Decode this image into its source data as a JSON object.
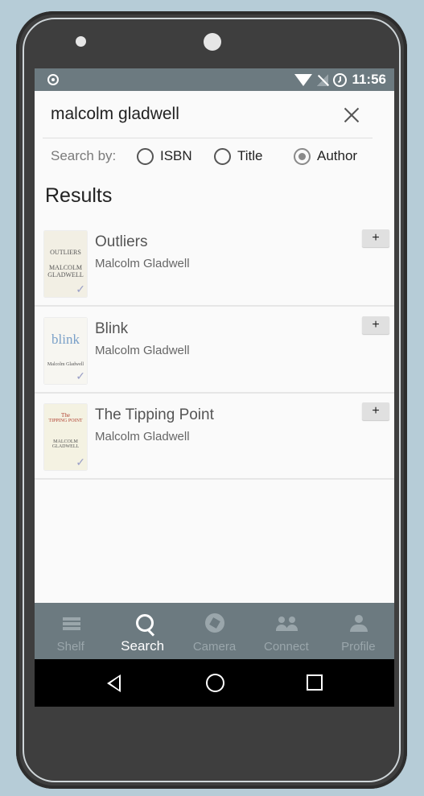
{
  "status_bar": {
    "time": "11:56"
  },
  "search": {
    "query": "malcolm gladwell",
    "search_by_label": "Search by:",
    "options": [
      {
        "label": "ISBN",
        "checked": false
      },
      {
        "label": "Title",
        "checked": false
      },
      {
        "label": "Author",
        "checked": true
      }
    ]
  },
  "results": {
    "title": "Results",
    "add_label": "+",
    "items": [
      {
        "title": "Outliers",
        "author": "Malcolm Gladwell",
        "cover_lines": [
          "OUTLIERS",
          "MALCOLM",
          "GLADWELL"
        ]
      },
      {
        "title": "Blink",
        "author": "Malcolm Gladwell",
        "cover_lines": [
          "blink",
          "Malcolm Gladwell"
        ]
      },
      {
        "title": "The Tipping Point",
        "author": "Malcolm Gladwell",
        "cover_lines": [
          "The",
          "TIPPING POINT",
          "MALCOLM",
          "GLADWELL"
        ]
      }
    ]
  },
  "bottom_nav": [
    {
      "label": "Shelf",
      "icon": "shelf-icon",
      "active": false
    },
    {
      "label": "Search",
      "icon": "search-icon",
      "active": true
    },
    {
      "label": "Camera",
      "icon": "camera-icon",
      "active": false
    },
    {
      "label": "Connect",
      "icon": "connect-icon",
      "active": false
    },
    {
      "label": "Profile",
      "icon": "profile-icon",
      "active": false
    }
  ],
  "colors": {
    "status_bar": "#6c7a80",
    "nav_active": "#ffffff",
    "nav_inactive": "#9aa6ab",
    "background": "#b6ccd7"
  }
}
